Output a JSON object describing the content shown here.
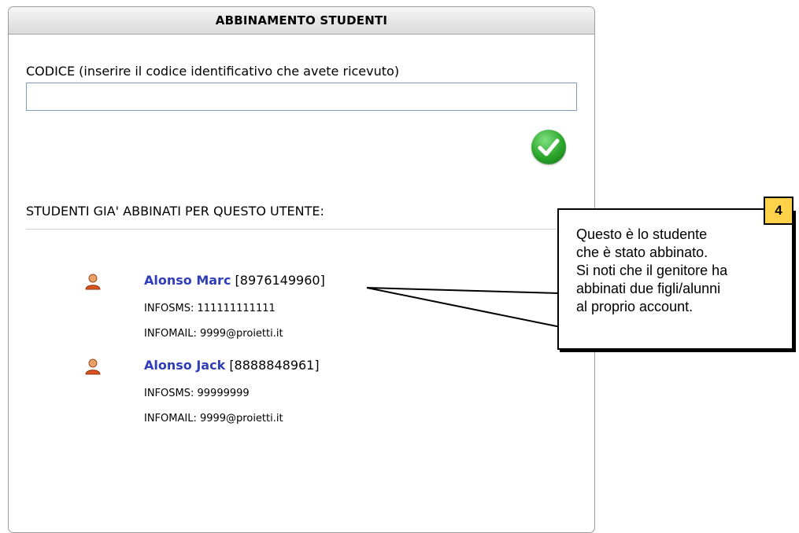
{
  "panel": {
    "title": "ABBINAMENTO STUDENTI",
    "code_label": "CODICE (inserire il codice identificativo che avete ricevuto)",
    "code_value": "",
    "confirm_icon": "check-icon",
    "linked_label": "STUDENTI GIA' ABBINATI PER QUESTO UTENTE:"
  },
  "students": [
    {
      "name": "Alonso Marc",
      "code": "[8976149960]",
      "infosms": "INFOSMS: 111111111111",
      "infomail": "INFOMAIL: 9999@proietti.it"
    },
    {
      "name": "Alonso Jack",
      "code": "[8888848961]",
      "infosms": "INFOSMS: 99999999",
      "infomail": "INFOMAIL: 9999@proietti.it"
    }
  ],
  "callout": {
    "step": "4",
    "lines": [
      "Questo è lo studente",
      "che è stato abbinato.",
      "Si noti che il genitore ha",
      "abbinati due figli/alunni",
      "al proprio account."
    ]
  },
  "colors": {
    "student_name": "#2f3eb8",
    "badge": "#ffd24a",
    "confirm": "#2aa52a"
  }
}
